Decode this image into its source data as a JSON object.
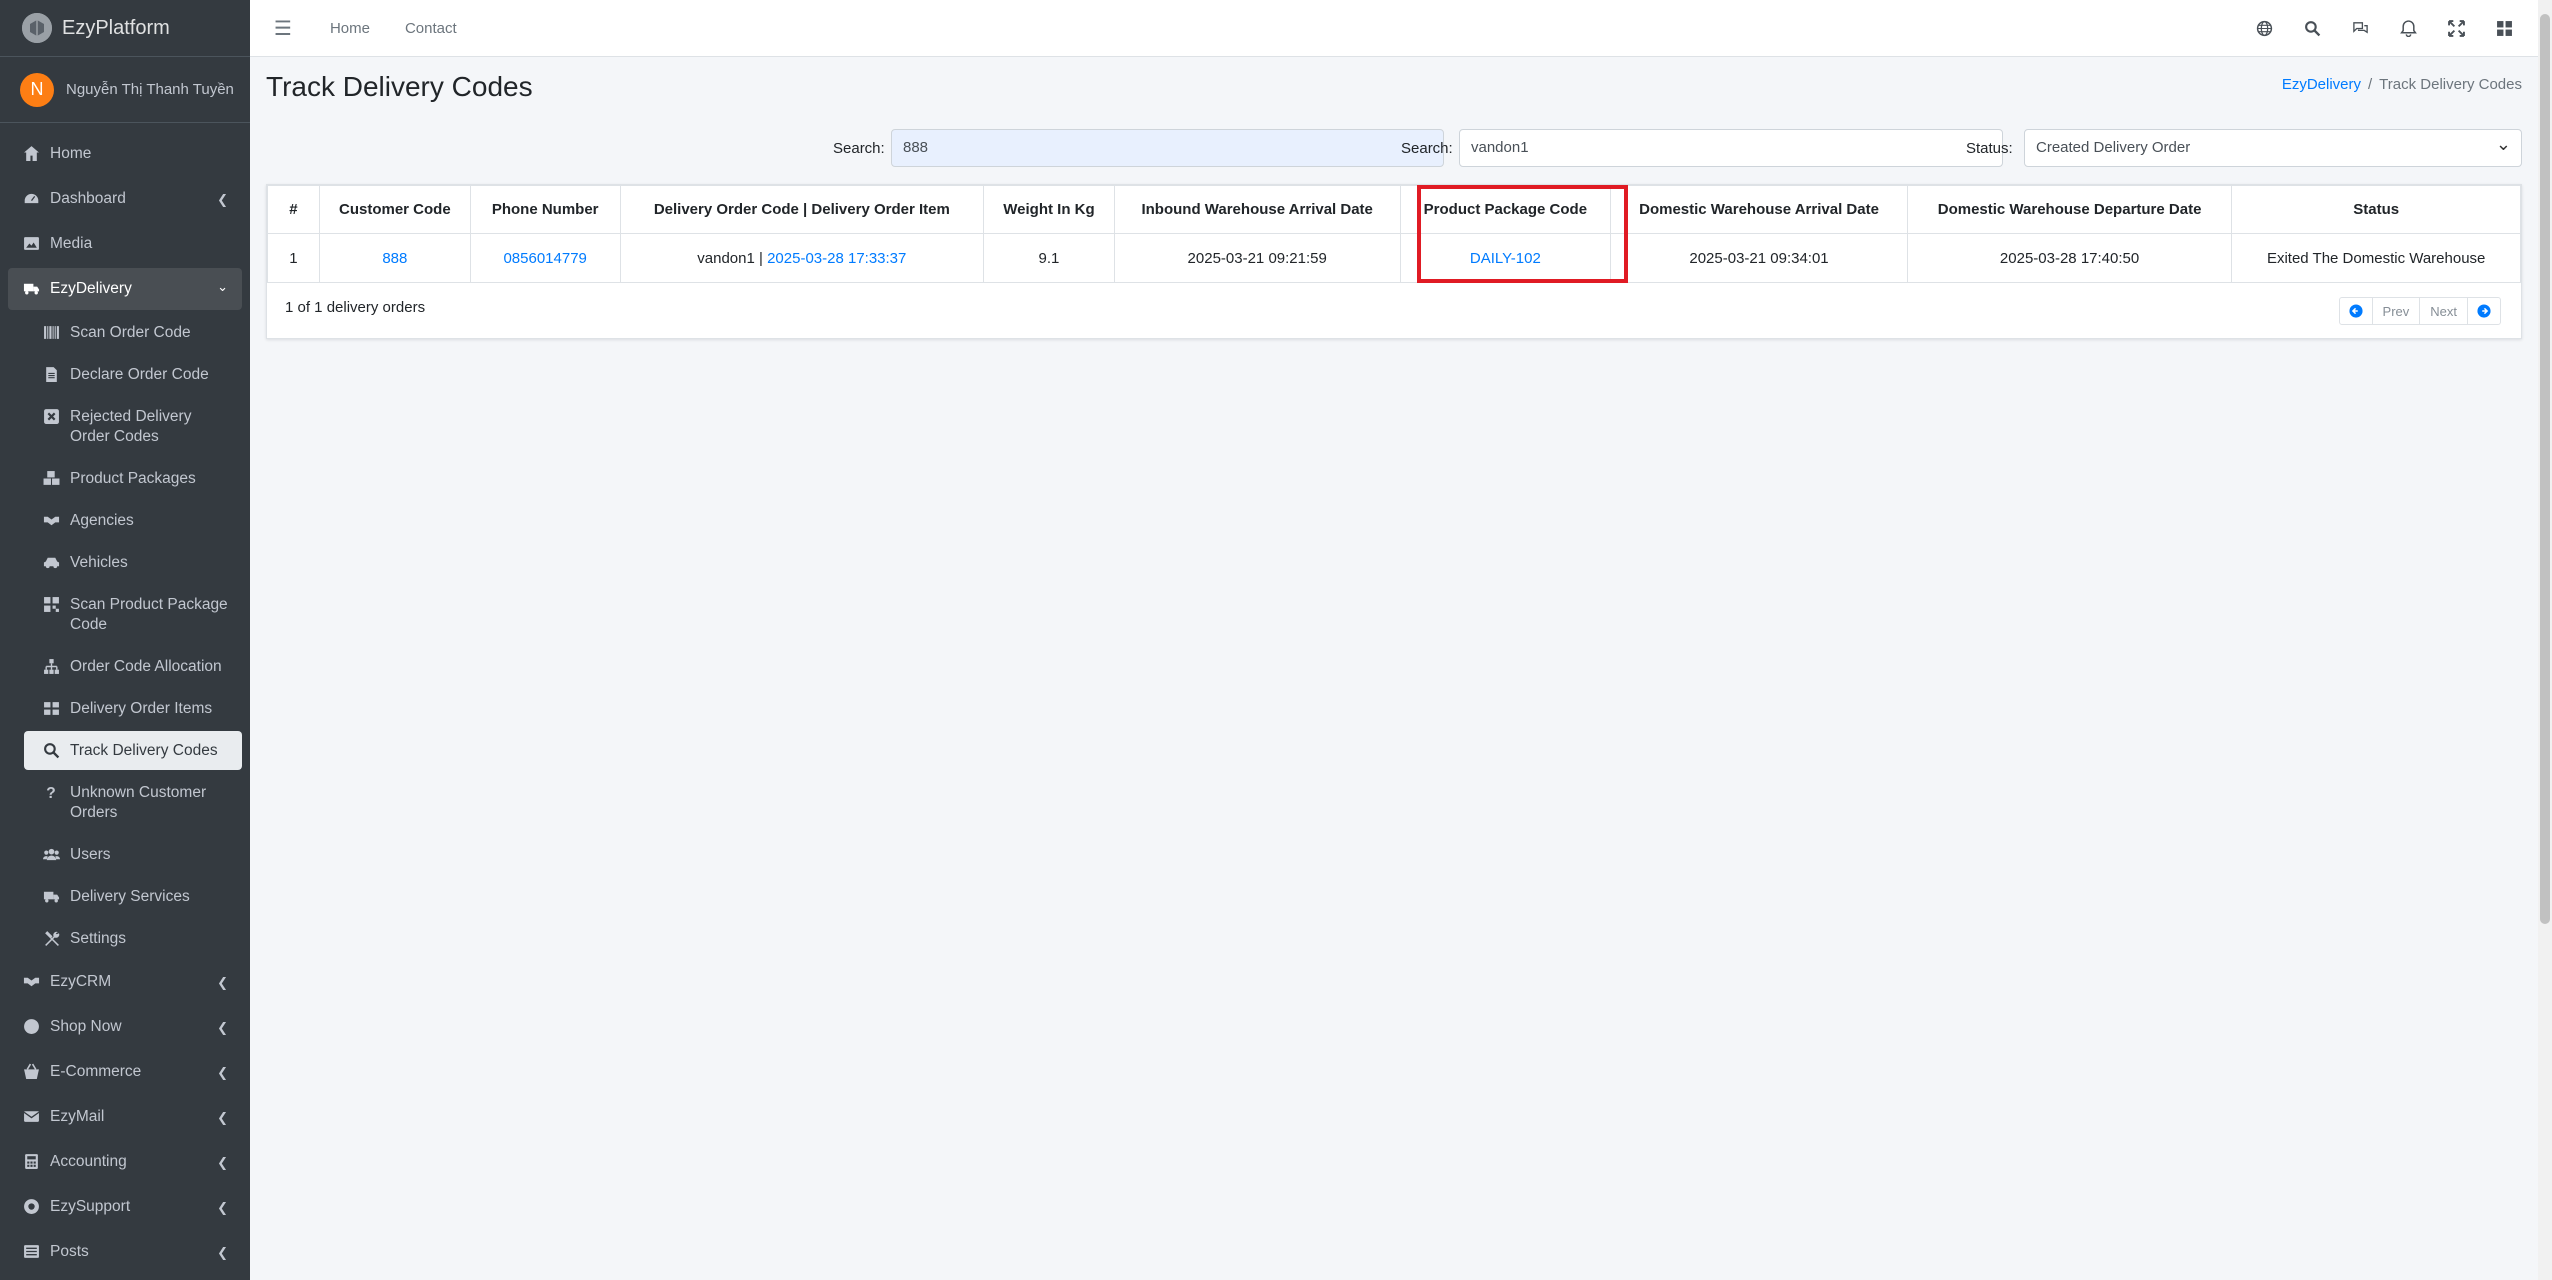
{
  "brand": {
    "name": "EzyPlatform",
    "logo_icon": "platform-logo-icon"
  },
  "user": {
    "initial": "N",
    "name": "Nguyễn Thị Thanh Tuyền"
  },
  "topnav": {
    "links": [
      "Home",
      "Contact"
    ],
    "icons": [
      "globe-icon",
      "search-icon",
      "chat-icon",
      "bell-icon",
      "fullscreen-icon",
      "apps-icon"
    ]
  },
  "sidebar": {
    "items": [
      {
        "label": "Home",
        "icon": "home-icon"
      },
      {
        "label": "Dashboard",
        "icon": "dashboard-icon",
        "has_children": true
      },
      {
        "label": "Media",
        "icon": "image-icon"
      },
      {
        "label": "EzyDelivery",
        "icon": "truck-icon",
        "open": true
      }
    ],
    "sub_items": [
      {
        "label": "Scan Order Code",
        "icon": "barcode-icon"
      },
      {
        "label": "Declare Order Code",
        "icon": "file-icon"
      },
      {
        "label": "Rejected Delivery Order Codes",
        "icon": "x-square-icon"
      },
      {
        "label": "Product Packages",
        "icon": "boxes-icon"
      },
      {
        "label": "Agencies",
        "icon": "handshake-icon"
      },
      {
        "label": "Vehicles",
        "icon": "car-icon"
      },
      {
        "label": "Scan Product Package Code",
        "icon": "qrcode-icon"
      },
      {
        "label": "Order Code Allocation",
        "icon": "sitemap-icon"
      },
      {
        "label": "Delivery Order Items",
        "icon": "table-icon"
      },
      {
        "label": "Track Delivery Codes",
        "icon": "search-icon",
        "active": true
      },
      {
        "label": "Unknown Customer Orders",
        "icon": "question-icon"
      },
      {
        "label": "Users",
        "icon": "users-icon"
      },
      {
        "label": "Delivery Services",
        "icon": "truck-icon"
      },
      {
        "label": "Settings",
        "icon": "tools-icon"
      }
    ],
    "bottom_items": [
      {
        "label": "EzyCRM",
        "icon": "handshake-icon"
      },
      {
        "label": "Shop Now",
        "icon": "circle-icon"
      },
      {
        "label": "E-Commerce",
        "icon": "basket-icon"
      },
      {
        "label": "EzyMail",
        "icon": "envelope-icon"
      },
      {
        "label": "Accounting",
        "icon": "calculator-icon"
      },
      {
        "label": "EzySupport",
        "icon": "lifering-icon"
      },
      {
        "label": "Posts",
        "icon": "newspaper-icon"
      }
    ]
  },
  "page": {
    "title": "Track Delivery Codes",
    "breadcrumb": {
      "parent": "EzyDelivery",
      "separator": "/",
      "current": "Track Delivery Codes"
    }
  },
  "filters": {
    "search1": {
      "label": "Search:",
      "value": "888"
    },
    "search2": {
      "label": "Search:",
      "value": "vandon1"
    },
    "status": {
      "label": "Status:",
      "value": "Created Delivery Order"
    }
  },
  "table": {
    "headers": [
      "#",
      "Customer Code",
      "Phone Number",
      "Delivery Order Code | Delivery Order Item",
      "Weight In Kg",
      "Inbound Warehouse Arrival Date",
      "Product Package Code",
      "Domestic Warehouse Arrival Date",
      "Domestic Warehouse Departure Date",
      "Status"
    ],
    "rows": [
      {
        "index": "1",
        "customer_code": "888",
        "phone": "0856014779",
        "order_code": "vandon1",
        "order_sep": " | ",
        "order_item": "2025-03-28 17:33:37",
        "weight": "9.1",
        "inbound_date": "2025-03-21 09:21:59",
        "package_code": "DAILY-102",
        "domestic_arrival": "2025-03-21 09:34:01",
        "domestic_departure": "2025-03-28 17:40:50",
        "status": "Exited The Domestic Warehouse"
      }
    ],
    "summary": "1 of 1 delivery orders"
  },
  "pagination": {
    "prev": "Prev",
    "next": "Next"
  },
  "colors": {
    "sidebar_bg": "#343a40",
    "link": "#007bff",
    "highlight": "#e01b24",
    "avatar": "#fd7e14"
  }
}
